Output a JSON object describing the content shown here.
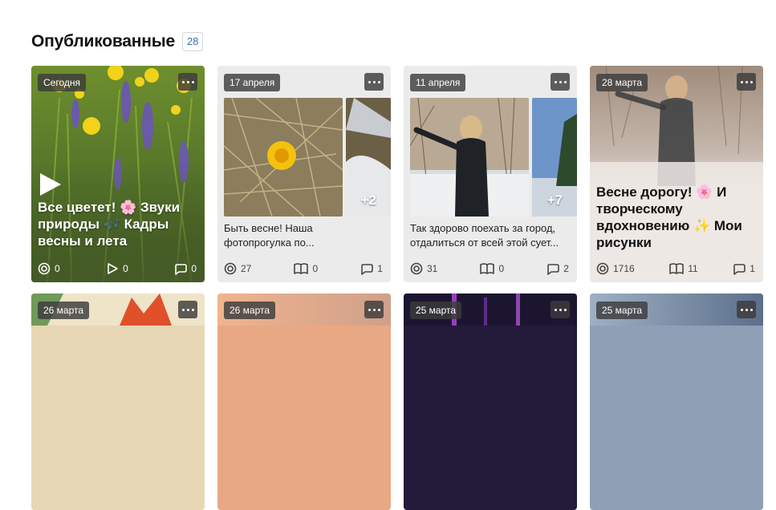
{
  "section": {
    "title": "Опубликованные",
    "count": "28"
  },
  "cards": [
    {
      "date": "Сегодня",
      "title": "Все цветет! 🌸 Звуки природы 🎶 Кадры весны и лета",
      "views": "0",
      "plays": "0",
      "comments": "0"
    },
    {
      "date": "17 апреля",
      "excerpt_line1": "Быть весне! Наша",
      "excerpt_line2": "фотопрогулка по...",
      "extra_photos": "+2",
      "views": "27",
      "reads": "0",
      "comments": "1"
    },
    {
      "date": "11 апреля",
      "excerpt_line1": "Так здорово поехать за город,",
      "excerpt_line2": "отдалиться от всей этой сует...",
      "extra_photos": "+7",
      "views": "31",
      "reads": "0",
      "comments": "2"
    },
    {
      "date": "28 марта",
      "title": "Весне дорогу! 🌸 И творческому вдохновению ✨ Мои рисунки",
      "views": "1716",
      "reads": "11",
      "comments": "1"
    }
  ],
  "next_row": [
    {
      "date": "26 марта"
    },
    {
      "date": "26 марта"
    },
    {
      "date": "25 марта"
    },
    {
      "date": "25 марта"
    }
  ]
}
